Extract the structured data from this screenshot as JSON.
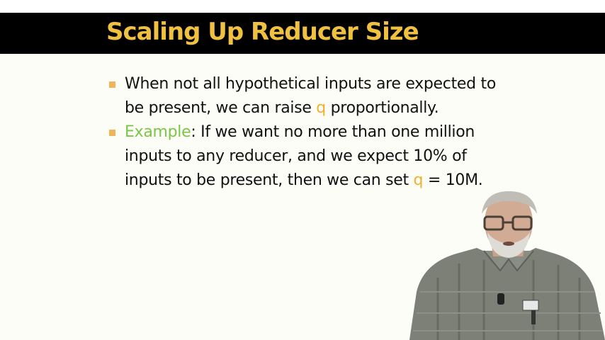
{
  "title": "Scaling Up Reducer Size",
  "bullets": [
    {
      "parts": {
        "a": "When not all hypothetical inputs are expected to be present, we can raise ",
        "q": "q",
        "b": " proportionally."
      }
    },
    {
      "parts": {
        "label": "Example",
        "a": ": If we want no more than one million inputs to any reducer, and we expect 10% of inputs to be present, then we can set ",
        "q": "q",
        "b": " = 10M."
      }
    }
  ],
  "colors": {
    "title": "#f0c040",
    "title_bar": "#000000",
    "bullet_marker": "#f0b45a",
    "highlight_q": "#f0b12a",
    "highlight_example": "#7cc545"
  },
  "icons": [
    "presenter-video"
  ]
}
